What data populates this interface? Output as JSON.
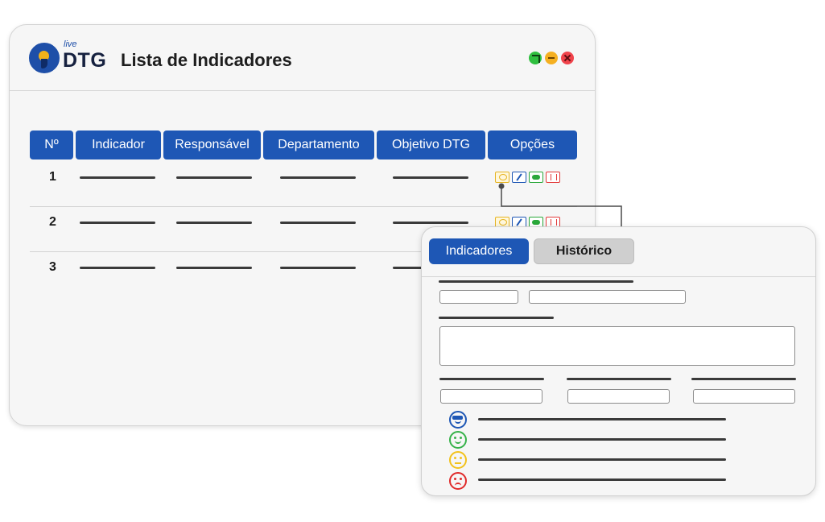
{
  "window": {
    "logo_small": "live",
    "logo_text": "DTG",
    "title": "Lista de Indicadores"
  },
  "table": {
    "headers": [
      "Nº",
      "Indicador",
      "Responsável",
      "Departamento",
      "Objetivo DTG",
      "Opções"
    ],
    "rows": [
      {
        "number": "1"
      },
      {
        "number": "2"
      },
      {
        "number": "3"
      }
    ]
  },
  "icons": {
    "row_options": [
      "view-icon",
      "edit-icon",
      "toggle-icon",
      "delete-icon"
    ],
    "window_controls": [
      "maximize-icon",
      "minimize-icon",
      "close-icon"
    ],
    "ratings": [
      "cool-face-icon",
      "happy-face-icon",
      "neutral-face-icon",
      "sad-face-icon"
    ]
  },
  "colors": {
    "accent_blue": "#1e57b5",
    "view_yellow": "#e6b422",
    "toggle_green": "#2aa83a",
    "delete_red": "#e23a3a",
    "rating_blue": "#1e57b5",
    "rating_green": "#37b24a",
    "rating_yellow": "#f2c21c",
    "rating_red": "#e02b2b"
  },
  "popup": {
    "tabs": [
      "Indicadores",
      "Histórico"
    ]
  }
}
